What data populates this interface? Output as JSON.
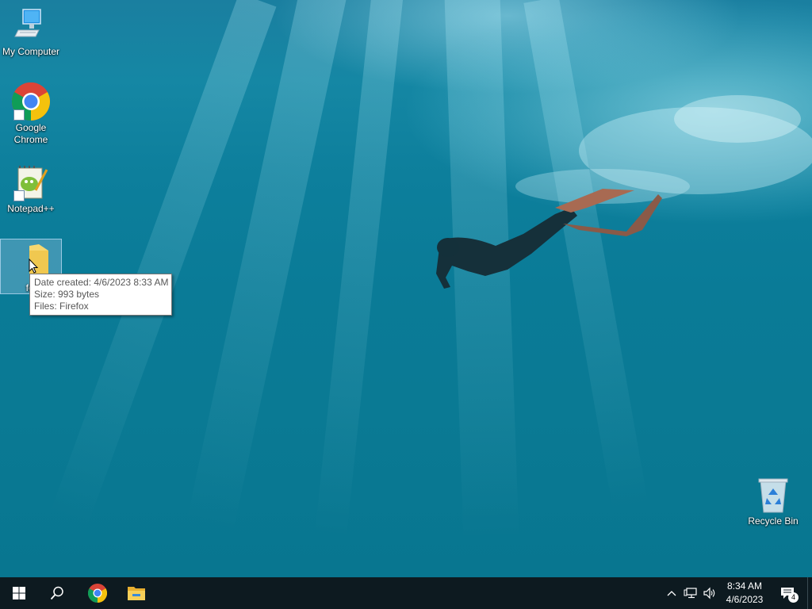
{
  "desktop": {
    "icons": [
      {
        "label": "My Computer",
        "icon": "computer-icon"
      },
      {
        "label": "Google Chrome",
        "icon": "chrome-icon"
      },
      {
        "label": "Notepad++",
        "icon": "notepad-plus-plus-icon"
      },
      {
        "label": "fol",
        "icon": "folder-icon"
      },
      {
        "label": "Recycle Bin",
        "icon": "recycle-bin-icon"
      }
    ],
    "tooltip": {
      "date_created": "Date created: 4/6/2023 8:33 AM",
      "size": "Size: 993 bytes",
      "files": "Files: Firefox"
    }
  },
  "taskbar": {
    "start_icon": "windows-start-icon",
    "search_icon": "search-icon",
    "pinned": [
      "chrome-icon",
      "file-explorer-icon"
    ],
    "tray_icons": [
      "chevron-up-icon",
      "network-icon",
      "volume-icon"
    ],
    "clock": {
      "time": "8:34 AM",
      "date": "4/6/2023"
    },
    "notification_count": "4"
  },
  "colors": {
    "taskbar_bg": "#0d1a20",
    "water": "#0a7b97",
    "folder": "#f0c850"
  }
}
